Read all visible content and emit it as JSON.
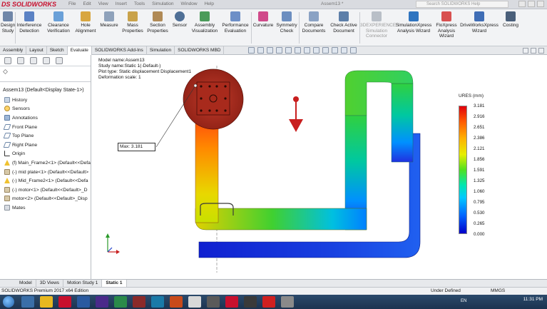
{
  "titlebar": {
    "logo": "DS SOLIDWORKS",
    "menu": [
      "File",
      "Edit",
      "View",
      "Insert",
      "Tools",
      "Simulation",
      "Window",
      "Help"
    ],
    "title": "Assem13 *",
    "search_placeholder": "Search SOLIDWORKS Help"
  },
  "ribbon": {
    "buttons": [
      {
        "line1": "Design",
        "line2": "Study",
        "color": "#6f86a8"
      },
      {
        "line1": "Interference",
        "line2": "Detection",
        "color": "#5b82c4"
      },
      {
        "line1": "Clearance",
        "line2": "Verification",
        "color": "#6aa0d8"
      },
      {
        "line1": "Hole",
        "line2": "Alignment",
        "color": "#d8a640"
      },
      {
        "line1": "Measure",
        "line2": "",
        "color": "#8fa2bb"
      },
      {
        "line1": "Mass",
        "line2": "Properties",
        "color": "#c9a24a"
      },
      {
        "line1": "Section",
        "line2": "Properties",
        "color": "#b08a56"
      },
      {
        "line1": "Sensor",
        "line2": "",
        "color": "#4f6f96"
      },
      {
        "line1": "Assembly",
        "line2": "Visualization",
        "color": "#4b9b5a"
      },
      {
        "line1": "Performance",
        "line2": "Evaluation",
        "color": "#6d8fc7"
      },
      {
        "line1": "Curvature",
        "line2": "",
        "color": "#d04a8a"
      },
      {
        "line1": "Symmetry",
        "line2": "Check",
        "color": "#6c8ec0"
      },
      {
        "line1": "Compare",
        "line2": "Documents",
        "color": "#8aa2c4"
      },
      {
        "line1": "Check Active",
        "line2": "Document",
        "color": "#5d7fa9"
      },
      {
        "line1": "3DEXPERIENCE",
        "line2": "Simulation",
        "line3": "Connector",
        "color": "#b9bfc7"
      },
      {
        "line1": "SimulationXpress",
        "line2": "Analysis Wizard",
        "color": "#2f74c0"
      },
      {
        "line1": "FloXpress",
        "line2": "Analysis",
        "line3": "Wizard",
        "color": "#d85050"
      },
      {
        "line1": "DriveWorksXpress",
        "line2": "Wizard",
        "color": "#3f6db5"
      },
      {
        "line1": "Costing",
        "line2": "",
        "color": "#4a5f7a"
      }
    ]
  },
  "tabs": [
    "Assembly",
    "Layout",
    "Sketch",
    "Evaluate",
    "SOLIDWORKS Add-Ins",
    "Simulation",
    "SOLIDWORKS MBD"
  ],
  "tree": {
    "root": "Assem13  (Default<Display State-1>)",
    "items": [
      {
        "label": "History",
        "icon": "folder-icon"
      },
      {
        "label": "Sensors",
        "icon": "sensor-icon"
      },
      {
        "label": "Annotations",
        "icon": "annotations-icon"
      },
      {
        "label": "Front Plane",
        "icon": "plane-icon"
      },
      {
        "label": "Top Plane",
        "icon": "plane-icon"
      },
      {
        "label": "Right Plane",
        "icon": "plane-icon"
      },
      {
        "label": "Origin",
        "icon": "origin-icon"
      },
      {
        "label": "(f) Main_Frame2<1> (Default<<Defa",
        "icon": "warning-icon"
      },
      {
        "label": "(-) mid plate<1> (Default<<Default>",
        "icon": "part-icon"
      },
      {
        "label": "(-) Mid_Frame2<1> (Default<<Defa",
        "icon": "warning-icon"
      },
      {
        "label": "(-) motor<1> (Default<<Default>_D",
        "icon": "part-icon"
      },
      {
        "label": "motor<2> (Default<<Default>_Disp",
        "icon": "part-icon"
      },
      {
        "label": "Mates",
        "icon": "mates-icon"
      }
    ]
  },
  "study": {
    "line1": "Model name:Assem13",
    "line2": "Study name:Static 1(-Default-)",
    "line3": "Plot type: Static displacement Displacement1",
    "line4": "Deformation scale: 1"
  },
  "legend": {
    "title": "URES (mm)",
    "values": [
      "3.181",
      "2.916",
      "2.651",
      "2.386",
      "2.121",
      "1.856",
      "1.591",
      "1.325",
      "1.060",
      "0.795",
      "0.530",
      "0.265",
      "0.000"
    ]
  },
  "probe": {
    "label": "Max:",
    "value": "3.181"
  },
  "bottom_tabs": [
    "Model",
    "3D Views",
    "Motion Study 1",
    "Static 1"
  ],
  "status": {
    "left": "SOLIDWORKS Premium 2017 x64 Edition",
    "middle": "Under Defined",
    "units": "MMGS"
  },
  "taskbar": {
    "lang": "EN",
    "time": "11:31 PM"
  }
}
